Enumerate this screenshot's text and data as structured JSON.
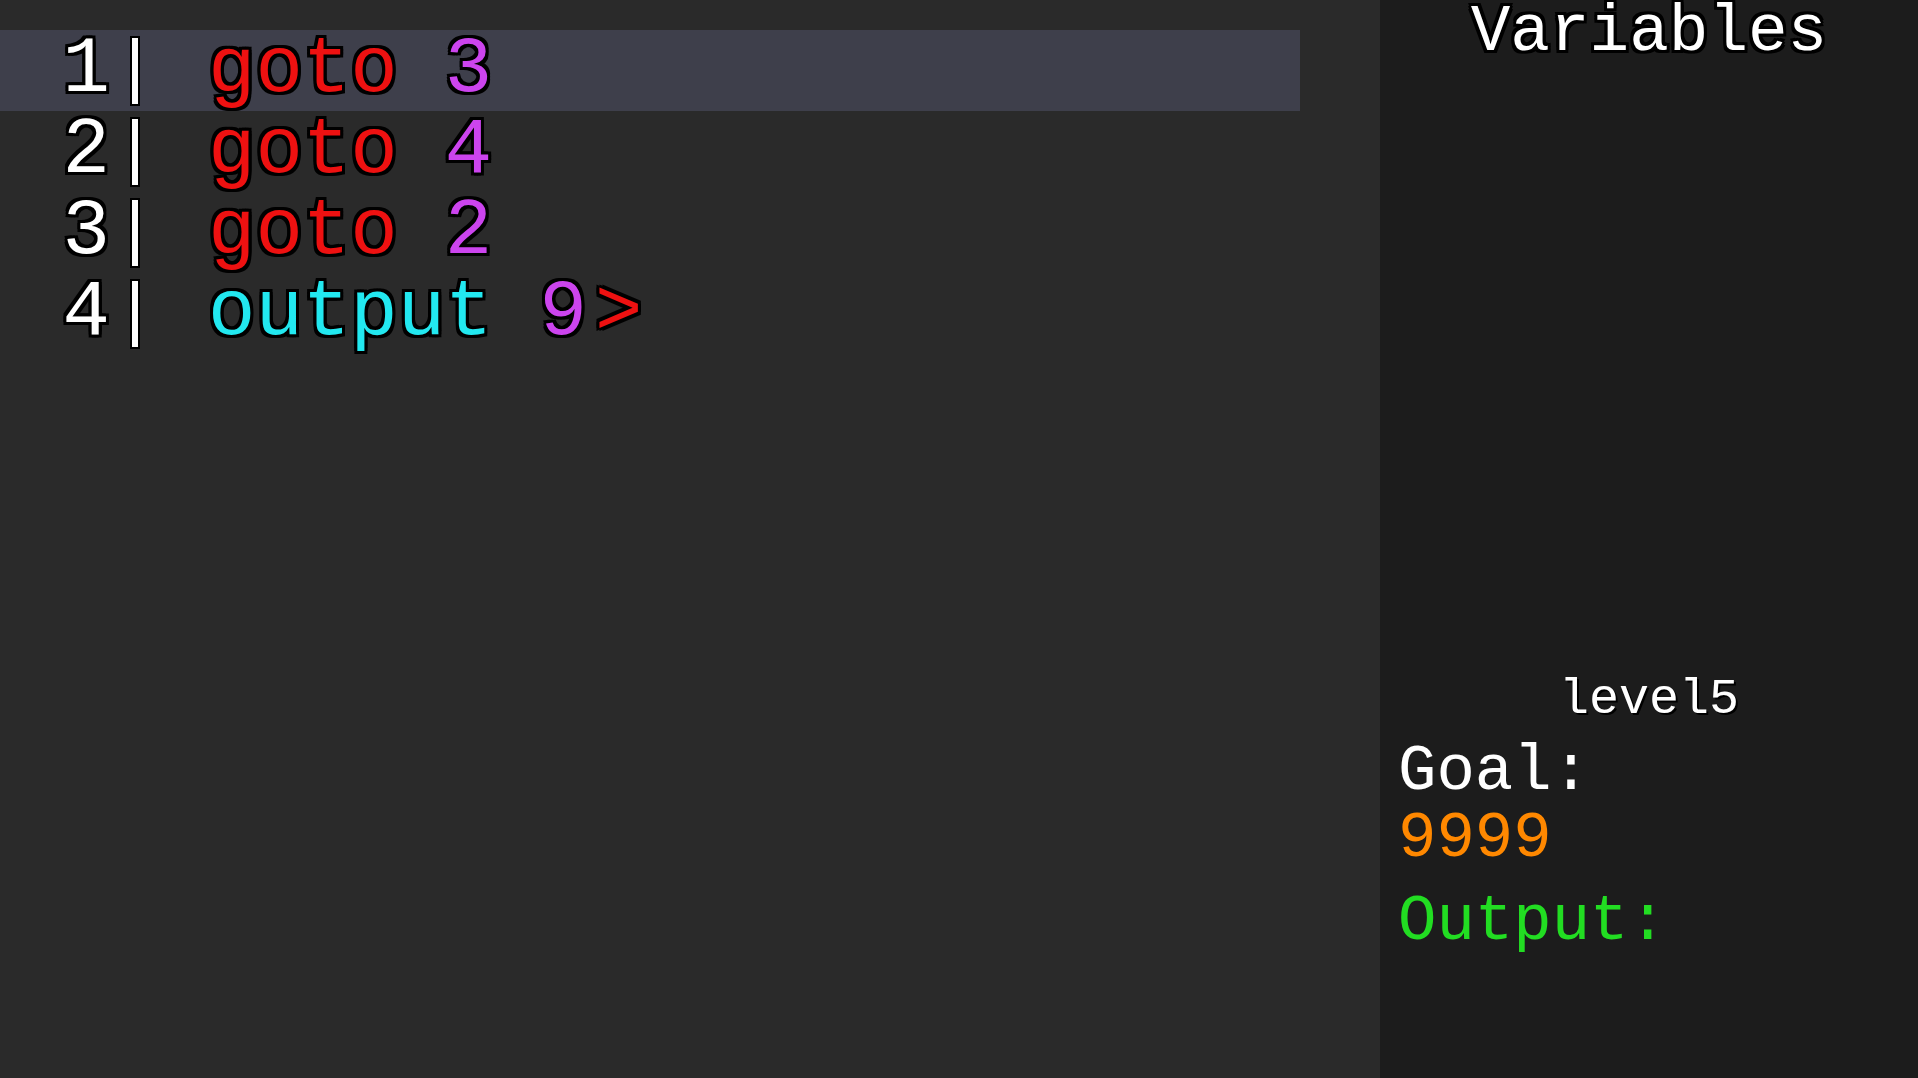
{
  "editor": {
    "lines": [
      {
        "number": "1",
        "selected": true,
        "tokens": [
          {
            "kind": "keyword",
            "text": "goto"
          },
          {
            "kind": "number",
            "text": "3"
          }
        ]
      },
      {
        "number": "2",
        "selected": false,
        "tokens": [
          {
            "kind": "keyword",
            "text": "goto"
          },
          {
            "kind": "number",
            "text": "4"
          }
        ]
      },
      {
        "number": "3",
        "selected": false,
        "tokens": [
          {
            "kind": "keyword",
            "text": "goto"
          },
          {
            "kind": "number",
            "text": "2"
          }
        ]
      },
      {
        "number": "4",
        "selected": false,
        "tokens": [
          {
            "kind": "command",
            "text": "output"
          },
          {
            "kind": "number",
            "text": "9"
          },
          {
            "kind": "cursor",
            "text": ">"
          }
        ]
      }
    ]
  },
  "sidebar": {
    "title": "Variables",
    "level_name": "level5",
    "goal_label": "Goal:",
    "goal_value": "9999",
    "output_label": "Output:"
  }
}
